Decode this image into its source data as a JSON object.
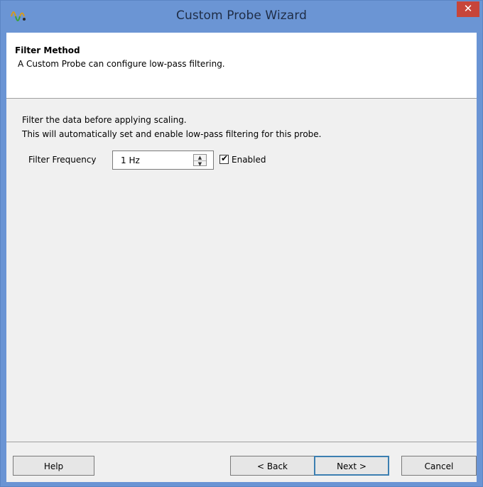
{
  "window": {
    "title": "Custom Probe Wizard",
    "close_glyph": "✕",
    "icon": "probe-app-icon"
  },
  "header": {
    "title": "Filter Method",
    "subtitle": "A Custom Probe can configure low-pass filtering."
  },
  "body": {
    "line1": "Filter the data before applying scaling.",
    "line2": "This will automatically set and enable low-pass filtering for this probe."
  },
  "filter": {
    "label": "Filter Frequency",
    "value": "1 Hz",
    "enabled_label": "Enabled",
    "enabled": true,
    "check_glyph": "✔"
  },
  "buttons": {
    "help": "Help",
    "back": "< Back",
    "next": "Next >",
    "cancel": "Cancel"
  },
  "colors": {
    "titlebar": "#6b95d4",
    "close": "#c7453a",
    "panel": "#f0f0f0",
    "default_button_border": "#3c7fb1"
  }
}
